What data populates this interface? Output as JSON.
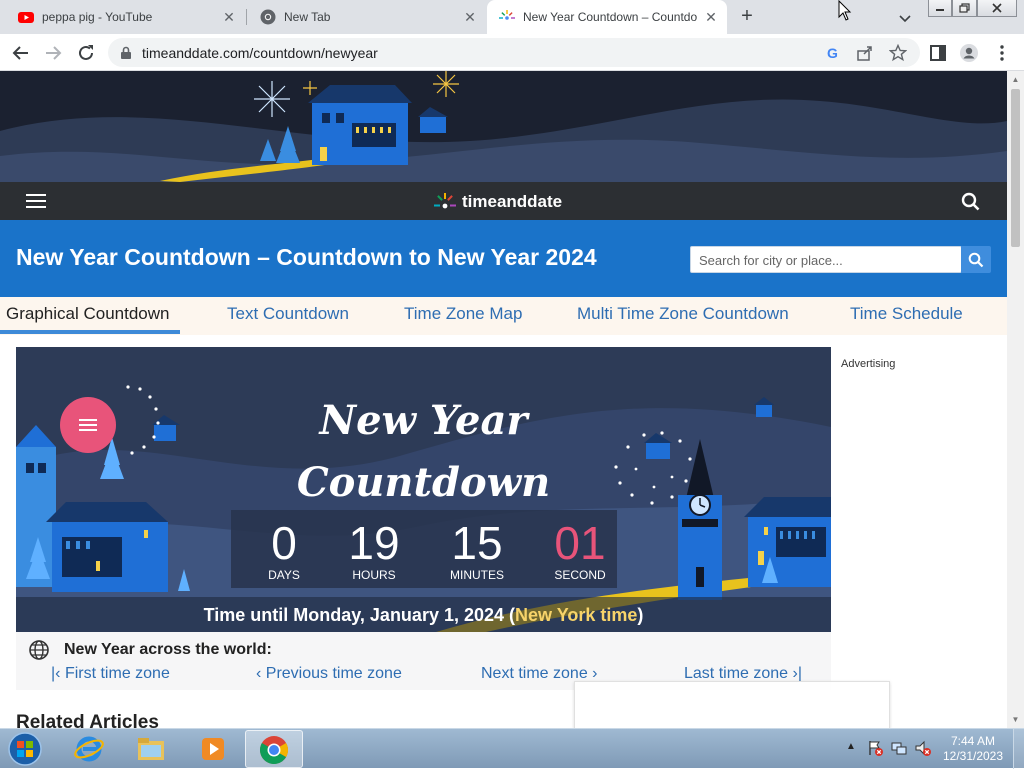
{
  "browser": {
    "tabs": [
      {
        "title": "peppa pig - YouTube",
        "icon": "youtube-icon"
      },
      {
        "title": "New Tab",
        "icon": "chrome-icon"
      },
      {
        "title": "New Year Countdown – Countdo",
        "icon": "timeanddate-icon",
        "active": true
      }
    ],
    "url": "timeanddate.com/countdown/newyear"
  },
  "site": {
    "brand": "timeanddate",
    "title": "New Year Countdown – Countdown to New Year 2024",
    "search_placeholder": "Search for city or place...",
    "subnav": [
      "Graphical Countdown",
      "Text Countdown",
      "Time Zone Map",
      "Multi Time Zone Countdown",
      "Time Schedule"
    ],
    "advertising": "Advertising",
    "related": "Related Articles"
  },
  "countdown": {
    "title_line1": "New Year",
    "title_line2": "Countdown",
    "days": "0",
    "days_label": "DAYS",
    "hours": "19",
    "hours_label": "HOURS",
    "minutes": "15",
    "minutes_label": "MINUTES",
    "seconds": "01",
    "seconds_label": "SECOND",
    "until_prefix": "Time until Monday, January 1, 2024 (",
    "until_location": "New York time",
    "until_suffix": ")",
    "seconds_color": "#e8547a"
  },
  "world": {
    "heading": "New Year across the world:",
    "first": "First time zone",
    "previous": "Previous time zone",
    "next": "Next time zone",
    "last": "Last time zone"
  },
  "taskbar": {
    "time": "7:44 AM",
    "date": "12/31/2023"
  }
}
